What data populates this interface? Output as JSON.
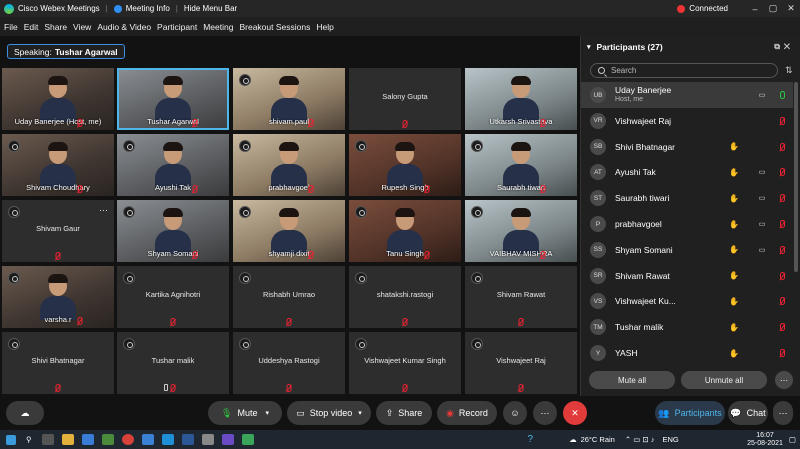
{
  "app": {
    "title": "Cisco Webex Meetings",
    "meeting_info": "Meeting Info",
    "hide_menu": "Hide Menu Bar",
    "status": "Connected",
    "win_controls": [
      "–",
      "▢",
      "✕"
    ]
  },
  "menu": [
    "File",
    "Edit",
    "Share",
    "View",
    "Audio & Video",
    "Participant",
    "Meeting",
    "Breakout Sessions",
    "Help"
  ],
  "speaking": {
    "label": "Speaking:",
    "name": "Tushar Agarwal"
  },
  "tiles": [
    {
      "name": "Uday Banerjee  (Host, me)",
      "video": true
    },
    {
      "name": "Tushar Agarwal",
      "video": true,
      "active": true
    },
    {
      "name": "shivam.paul",
      "video": true
    },
    {
      "name": "Salony Gupta",
      "video": false
    },
    {
      "name": "Utkarsh Srivastava",
      "video": true
    },
    {
      "name": "Shivam Choudhary",
      "video": true
    },
    {
      "name": "Ayushi Tak",
      "video": true
    },
    {
      "name": "prabhavgoel",
      "video": true
    },
    {
      "name": "Rupesh Singh",
      "video": true
    },
    {
      "name": "Saurabh tiwari",
      "video": true
    },
    {
      "name": "Shivam Gaur",
      "video": false
    },
    {
      "name": "Shyam Somani",
      "video": true
    },
    {
      "name": "shyamji dixit",
      "video": true
    },
    {
      "name": "Tanu Singh",
      "video": true
    },
    {
      "name": "VAIBHAV MISHRA",
      "video": true
    },
    {
      "name": "varsha.r",
      "video": true
    },
    {
      "name": "Kartika Agnihotri",
      "video": false
    },
    {
      "name": "Rishabh Umrao",
      "video": false
    },
    {
      "name": "shatakshi.rastogi",
      "video": false
    },
    {
      "name": "Shivam Rawat",
      "video": false
    },
    {
      "name": "Shivi Bhatnagar",
      "video": false
    },
    {
      "name": "Tushar malik",
      "video": false
    },
    {
      "name": "Uddeshya Rastogi",
      "video": false
    },
    {
      "name": "Vishwajeet Kumar Singh",
      "video": false
    },
    {
      "name": "Vishwajeet Raj",
      "video": false
    }
  ],
  "panel": {
    "title": "Participants (27)",
    "search_placeholder": "Search",
    "participants": [
      {
        "initials": "UB",
        "name": "Uday Banerjee",
        "sub": "Host, me",
        "hand": false,
        "cam": true,
        "mic_on": true
      },
      {
        "initials": "VR",
        "name": "Vishwajeet Raj",
        "sub": "",
        "hand": false,
        "cam": false,
        "mic_on": false
      },
      {
        "initials": "SB",
        "name": "Shivi Bhatnagar",
        "sub": "",
        "hand": true,
        "cam": false,
        "mic_on": false
      },
      {
        "initials": "AT",
        "name": "Ayushi Tak",
        "sub": "",
        "hand": true,
        "cam": true,
        "mic_on": false
      },
      {
        "initials": "ST",
        "name": "Saurabh tiwari",
        "sub": "",
        "hand": true,
        "cam": true,
        "mic_on": false
      },
      {
        "initials": "P",
        "name": "prabhavgoel",
        "sub": "",
        "hand": true,
        "cam": true,
        "mic_on": false
      },
      {
        "initials": "SS",
        "name": "Shyam Somani",
        "sub": "",
        "hand": true,
        "cam": true,
        "mic_on": false
      },
      {
        "initials": "SR",
        "name": "Shivam Rawat",
        "sub": "",
        "hand": true,
        "cam": false,
        "mic_on": false
      },
      {
        "initials": "VS",
        "name": "Vishwajeet Ku...",
        "sub": "",
        "hand": true,
        "cam": false,
        "mic_on": false
      },
      {
        "initials": "TM",
        "name": "Tushar malik",
        "sub": "",
        "hand": true,
        "cam": false,
        "mic_on": false
      },
      {
        "initials": "Y",
        "name": "YASH",
        "sub": "",
        "hand": true,
        "cam": false,
        "mic_on": false
      }
    ],
    "mute_all": "Mute all",
    "unmute_all": "Unmute all"
  },
  "controls": {
    "mute": "Mute",
    "stop_video": "Stop video",
    "share": "Share",
    "record": "Record",
    "participants": "Participants",
    "chat": "Chat"
  },
  "taskbar": {
    "weather": "26°C  Rain",
    "lang": "ENG",
    "time": "16:07",
    "date": "25-08-2021"
  },
  "colors": {
    "accent": "#4fb6ea",
    "leave": "#e23b3b",
    "muted": "#ee2233",
    "unmuted": "#2ecc40"
  }
}
